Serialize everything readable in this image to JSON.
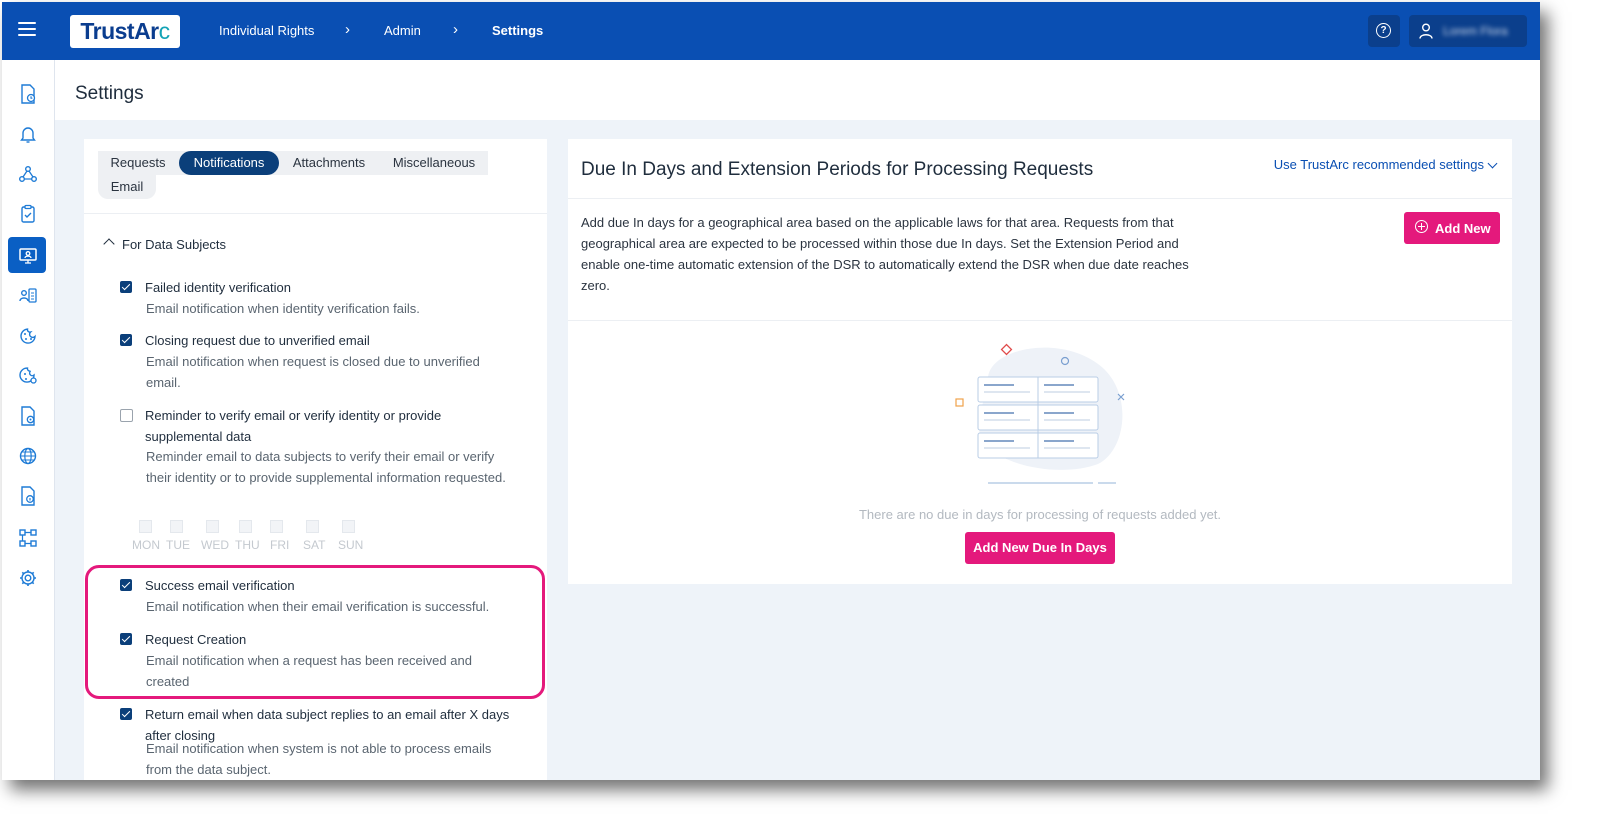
{
  "app": {
    "brand_main": "TrustAr",
    "brand_accent": "c",
    "brand_color": "#0a4fb3",
    "accent_color": "#e4197c"
  },
  "breadcrumb": [
    "Individual Rights",
    "Admin",
    "Settings"
  ],
  "user": {
    "name": "Lorem Flora"
  },
  "page": {
    "title": "Settings"
  },
  "tabs": [
    "Requests",
    "Notifications",
    "Attachments",
    "Miscellaneous",
    "Email"
  ],
  "active_tab": "Notifications",
  "section": {
    "title": "For Data Subjects"
  },
  "options": [
    {
      "title": "Failed identity verification",
      "desc": "Email notification when identity verification fails.",
      "checked": true
    },
    {
      "title": "Closing request due to unverified email",
      "desc": "Email notification when request is closed due to unverified email.",
      "checked": true
    },
    {
      "title": "Reminder to verify email or verify identity or provide supplemental data",
      "desc": "Reminder email to data subjects to verify their email or verify their identity or to provide supplemental information requested.",
      "checked": false
    },
    {
      "title": "Success email verification",
      "desc": "Email notification when their email verification is successful.",
      "checked": true
    },
    {
      "title": "Request Creation",
      "desc": "Email notification when a request has been received and created",
      "checked": true
    },
    {
      "title": "Return email when data subject replies to an email after X days after closing",
      "desc": "Email notification when system is not able to process emails from the data subject.",
      "checked": true
    }
  ],
  "days": [
    "MON",
    "TUE",
    "WED",
    "THU",
    "FRI",
    "SAT",
    "SUN"
  ],
  "due_panel": {
    "title": "Due In Days and Extension Periods for Processing Requests",
    "recommend_link": "Use TrustArc recommended settings",
    "description": "Add due In days for a geographical area based on the applicable laws for that area. Requests from that geographical area are expected to be processed within those due In days. Set the Extension Period and enable one-time automatic extension of the DSR to automatically extend the DSR when due date reaches zero.",
    "add_new_label": "Add New",
    "empty_text": "There are no due in days for processing of requests added yet.",
    "add_due_label": "Add New Due In Days"
  },
  "sidebar_icons": [
    "document-clock-icon",
    "bell-icon",
    "network-icon",
    "clipboard-check-icon",
    "monitor-person-icon",
    "person-list-icon",
    "cookie-icon",
    "cookie-settings-icon",
    "document-settings-icon",
    "globe-icon",
    "document-info-icon",
    "workflow-icon",
    "gear-icon"
  ]
}
